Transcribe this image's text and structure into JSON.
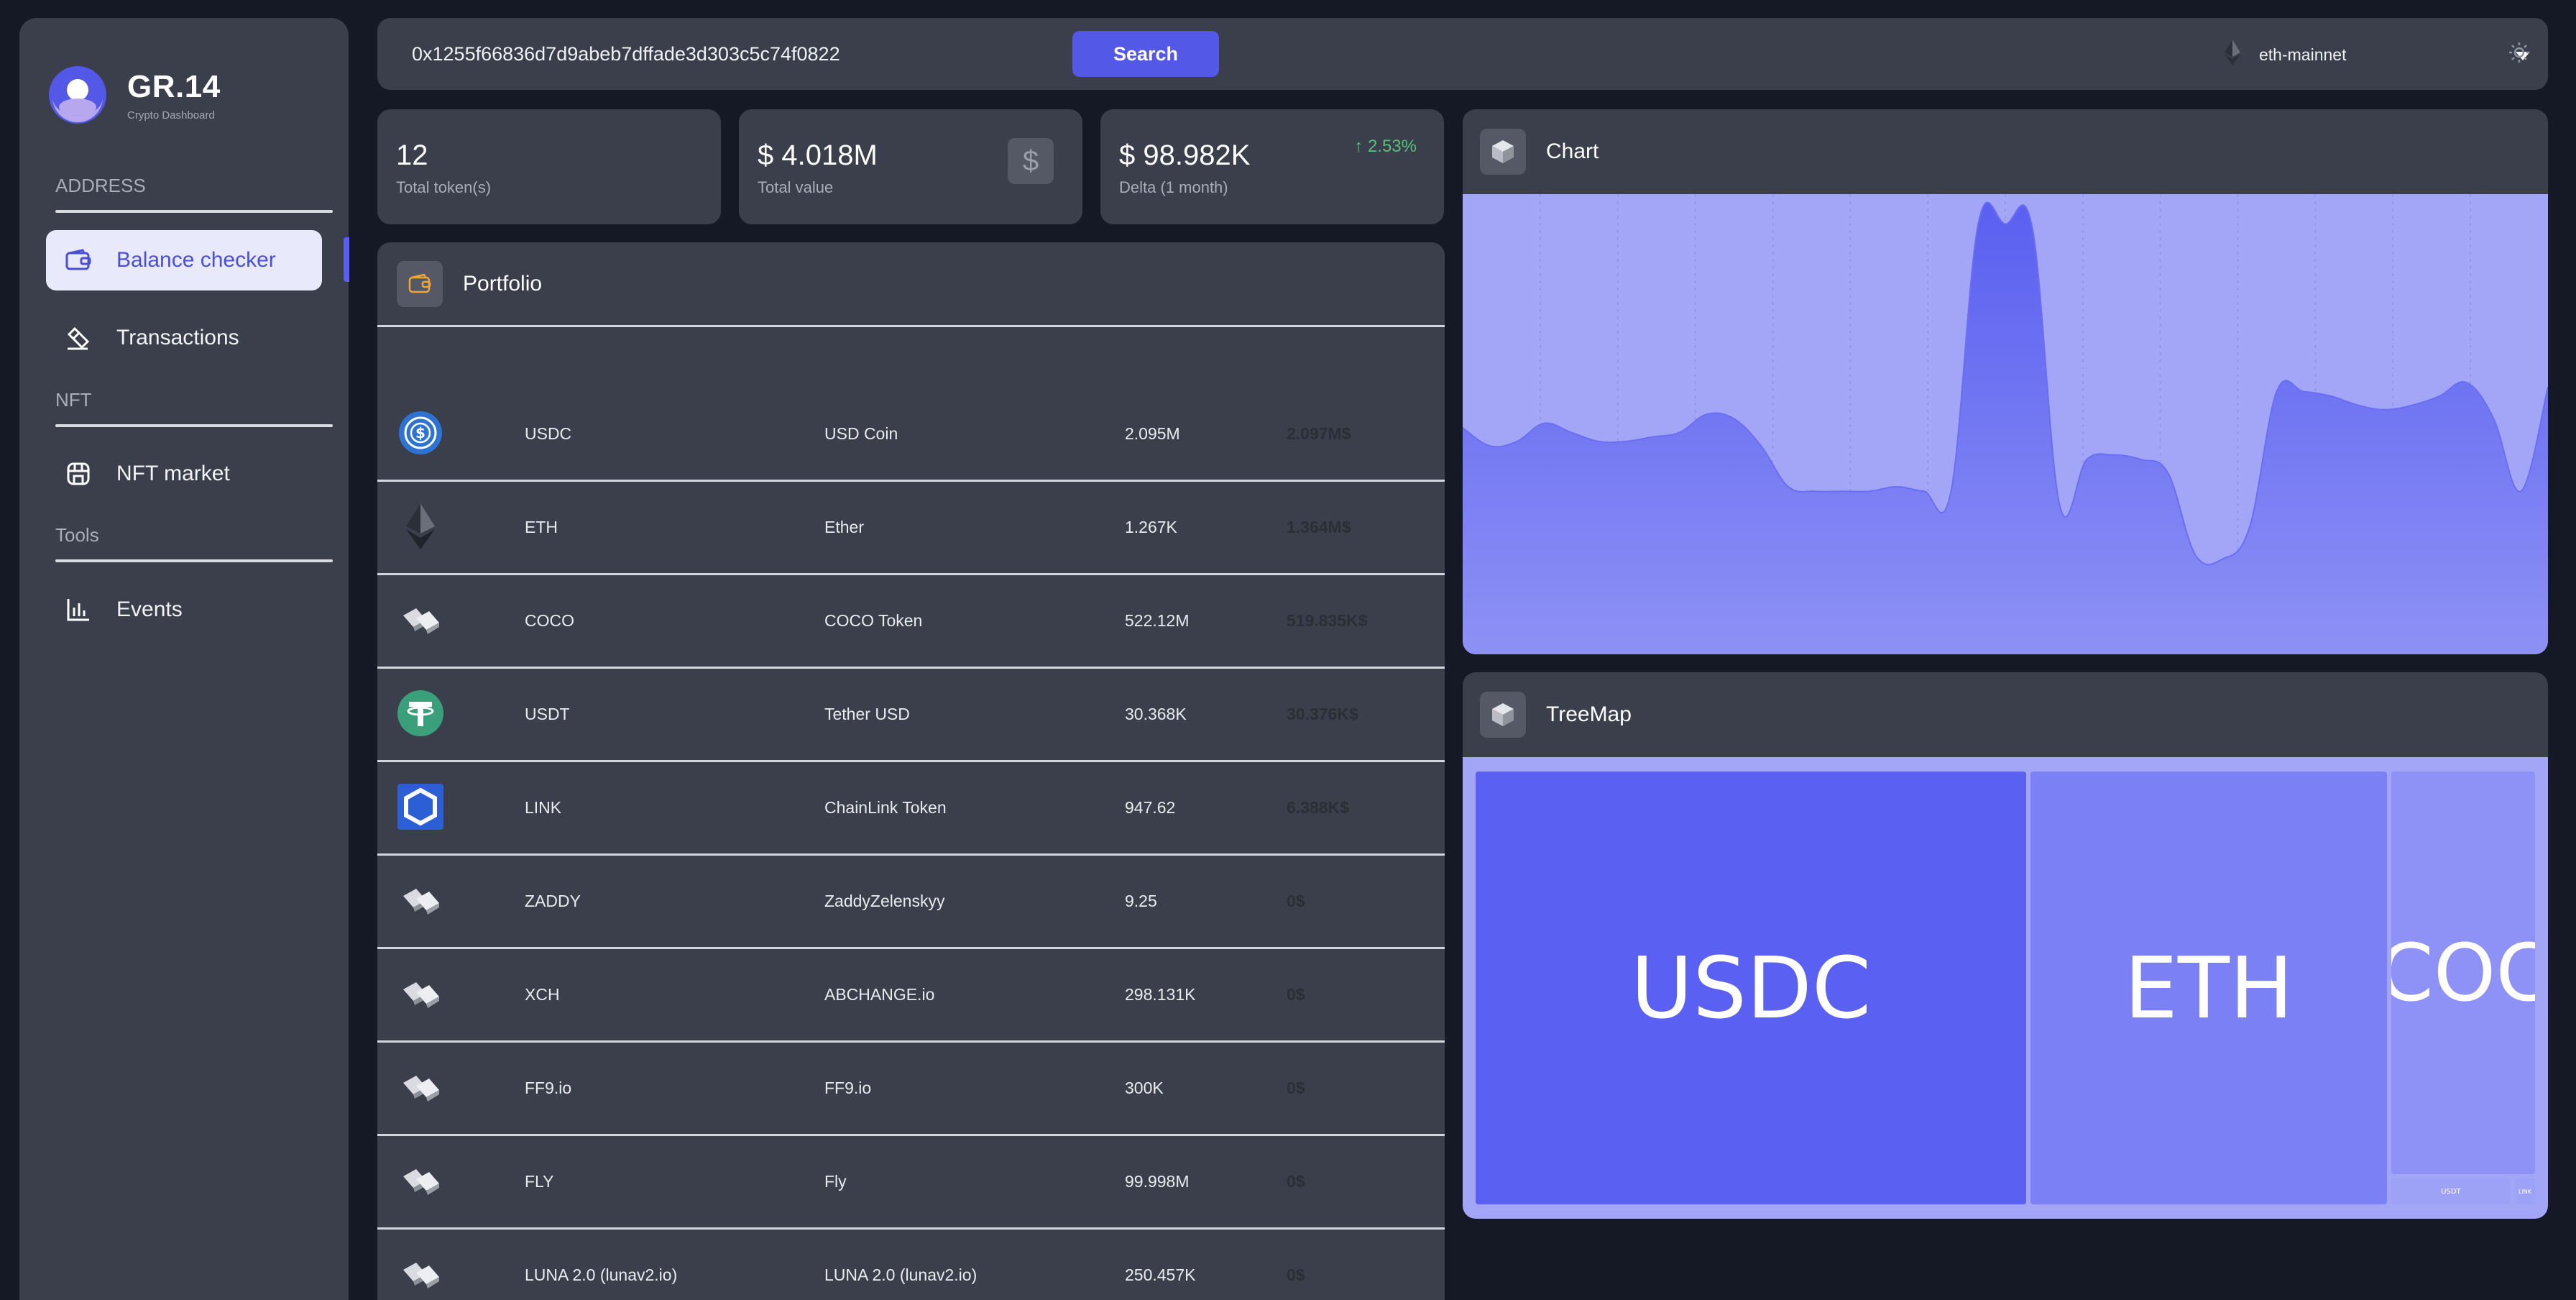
{
  "brand": {
    "title": "GR.14",
    "subtitle": "Crypto Dashboard"
  },
  "sidebar": {
    "sections": [
      {
        "heading": "ADDRESS"
      },
      {
        "heading": "NFT"
      },
      {
        "heading": "Tools"
      }
    ],
    "items": [
      {
        "label": "Balance checker",
        "icon": "wallet-icon",
        "active": true
      },
      {
        "label": "Transactions",
        "icon": "eraser-icon",
        "active": false
      },
      {
        "label": "NFT market",
        "icon": "store-icon",
        "active": false
      },
      {
        "label": "Events",
        "icon": "bar-chart-icon",
        "active": false
      }
    ]
  },
  "topbar": {
    "address": "0x1255f66836d7d9abeb7dffade3d303c5c74f0822",
    "search_label": "Search",
    "network": "eth-mainnet"
  },
  "stats": {
    "tokens": {
      "value": "12",
      "label": "Total token(s)"
    },
    "value": {
      "value": "$ 4.018M",
      "label": "Total value",
      "icon": "dollar-icon"
    },
    "delta": {
      "value": "$ 98.982K",
      "label": "Delta (1 month)",
      "change": "2.53%"
    }
  },
  "portfolio": {
    "title": "Portfolio",
    "rows": [
      {
        "symbol": "USDC",
        "name": "USD Coin",
        "balance": "2.095M",
        "value": "2.097M$",
        "icon": "usdc-icon"
      },
      {
        "symbol": "ETH",
        "name": "Ether",
        "balance": "1.267K",
        "value": "1.364M$",
        "icon": "eth-icon"
      },
      {
        "symbol": "COCO",
        "name": "COCO Token",
        "balance": "522.12M",
        "value": "519.835K$",
        "icon": "generic-token-icon"
      },
      {
        "symbol": "USDT",
        "name": "Tether USD",
        "balance": "30.368K",
        "value": "30.376K$",
        "icon": "usdt-icon"
      },
      {
        "symbol": "LINK",
        "name": "ChainLink Token",
        "balance": "947.62",
        "value": "6.388K$",
        "icon": "link-icon"
      },
      {
        "symbol": "ZADDY",
        "name": "ZaddyZelenskyy",
        "balance": "9.25",
        "value": "0$",
        "icon": "generic-token-icon"
      },
      {
        "symbol": "XCH",
        "name": "ABCHANGE.io",
        "balance": "298.131K",
        "value": "0$",
        "icon": "generic-token-icon"
      },
      {
        "symbol": "FF9.io",
        "name": "FF9.io",
        "balance": "300K",
        "value": "0$",
        "icon": "generic-token-icon"
      },
      {
        "symbol": "FLY",
        "name": "Fly",
        "balance": "99.998M",
        "value": "0$",
        "icon": "generic-token-icon"
      },
      {
        "symbol": "LUNA 2.0 (lunav2.io)",
        "name": "LUNA 2.0 (lunav2.io)",
        "balance": "250.457K",
        "value": "0$",
        "icon": "generic-token-icon"
      }
    ]
  },
  "chart_panel": {
    "title": "Chart"
  },
  "treemap_panel": {
    "title": "TreeMap",
    "tiles": [
      {
        "label": "USDC",
        "share": 2.097
      },
      {
        "label": "ETH",
        "share": 1.364
      },
      {
        "label": "COCO",
        "share": 0.52
      },
      {
        "label": "USDT",
        "share": 0.03
      },
      {
        "label": "LINK",
        "share": 0.006
      }
    ]
  },
  "chart_data": {
    "type": "area",
    "title": "",
    "xlabel": "",
    "ylabel": "",
    "grid": true,
    "fill_color": "#6a6ef2",
    "background": "#a3a6f7",
    "x": [
      0,
      1,
      2,
      3,
      4,
      5,
      6,
      7,
      8,
      9,
      10,
      11,
      12,
      13,
      14,
      15,
      16,
      17,
      18,
      19,
      20,
      21,
      22,
      23,
      24,
      25,
      26,
      27,
      28,
      29,
      30,
      31,
      32,
      33,
      34,
      35,
      36,
      37,
      38,
      39,
      40
    ],
    "values": [
      50,
      46,
      47,
      51,
      49,
      47,
      47,
      48,
      49,
      53,
      52,
      46,
      37,
      36,
      36,
      36,
      37,
      36,
      36,
      95,
      95,
      94,
      33,
      43,
      44,
      43,
      40,
      22,
      21,
      28,
      58,
      58,
      57,
      55,
      54,
      55,
      57,
      60,
      52,
      36,
      59
    ],
    "ylim": [
      0,
      100
    ]
  }
}
